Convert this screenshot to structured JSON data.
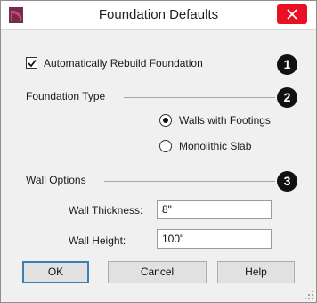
{
  "window": {
    "title": "Foundation Defaults",
    "app_icon": "chief-architect-icon",
    "close_icon": "close-icon",
    "close_color": "#e81123"
  },
  "auto_rebuild": {
    "label": "Automatically Rebuild Foundation",
    "checked": true,
    "badge": "1"
  },
  "foundation_type": {
    "heading": "Foundation Type",
    "badge": "2",
    "options": [
      {
        "label": "Walls with Footings",
        "selected": true
      },
      {
        "label": "Monolithic Slab",
        "selected": false
      }
    ]
  },
  "wall_options": {
    "heading": "Wall Options",
    "badge": "3",
    "thickness_label": "Wall Thickness:",
    "thickness_value": "8\"",
    "height_label": "Wall Height:",
    "height_value": "100\""
  },
  "buttons": {
    "ok": "OK",
    "cancel": "Cancel",
    "help": "Help"
  }
}
